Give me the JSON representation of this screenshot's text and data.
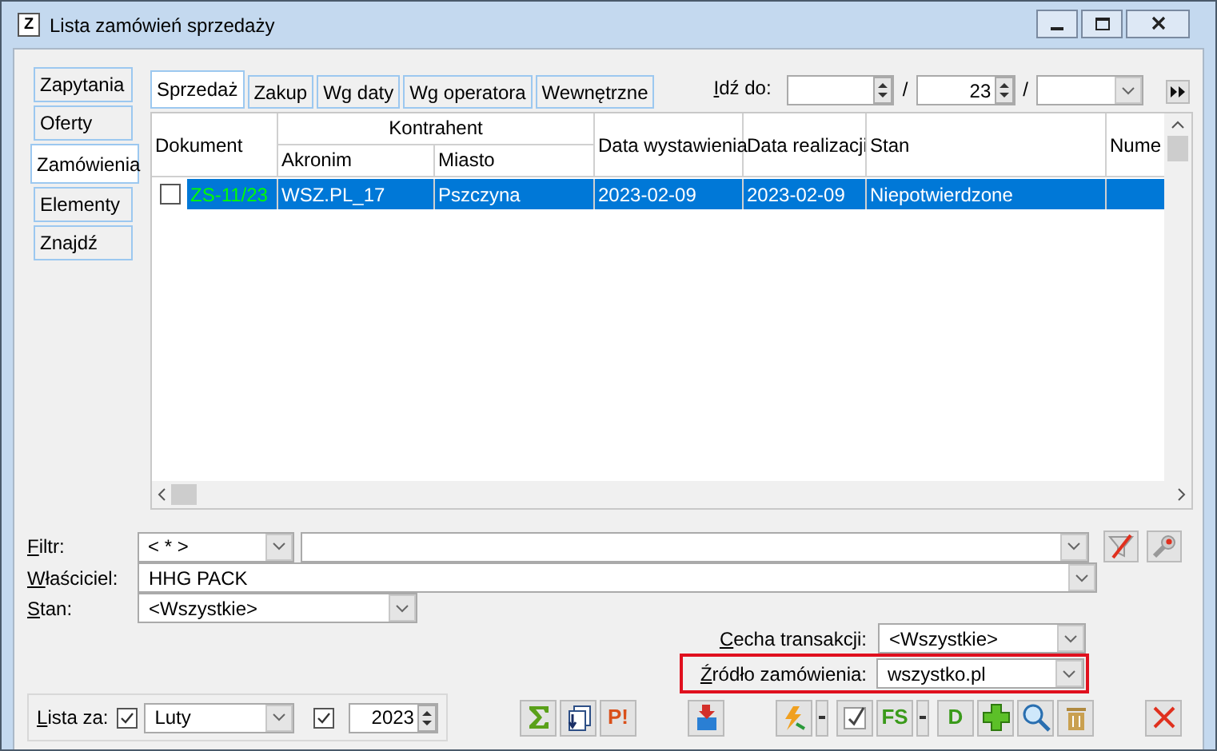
{
  "window": {
    "title": "Lista zamówień sprzedaży",
    "app_icon": "Z"
  },
  "sidebar": {
    "items": [
      {
        "label": "Zapytania",
        "selected": false
      },
      {
        "label": "Oferty",
        "selected": false
      },
      {
        "label": "Zamówienia",
        "selected": true
      },
      {
        "label": "Elementy",
        "selected": false
      },
      {
        "label": "Znajdź",
        "selected": false
      }
    ]
  },
  "tabs": [
    {
      "label": "Sprzedaż",
      "selected": true
    },
    {
      "label": "Zakup",
      "selected": false
    },
    {
      "label": "Wg daty",
      "selected": false
    },
    {
      "label": "Wg operatora",
      "selected": false
    },
    {
      "label": "Wewnętrzne",
      "selected": false
    }
  ],
  "goto": {
    "label": "Idź do:",
    "separator_1": "/",
    "number": "23",
    "separator_2": "/"
  },
  "table": {
    "columns": {
      "dokument": "Dokument",
      "kontrahent": "Kontrahent",
      "akronim": "Akronim",
      "miasto": "Miasto",
      "data_wystawienia": "Data wystawienia",
      "data_realizacji": "Data realizacji",
      "stan": "Stan",
      "column_8": "Nume"
    },
    "rows": [
      {
        "checked": false,
        "selected": true,
        "dokument": "ZS-11/23",
        "akronim": "WSZ.PL_17",
        "miasto": "Pszczyna",
        "data_wystawienia": "2023-02-09",
        "data_realizacji": "2023-02-09",
        "stan": "Niepotwierdzone"
      }
    ]
  },
  "filters": {
    "filtr": {
      "label": "Filtr:",
      "value": "< * >"
    },
    "wlasciciel": {
      "label": "Właściciel:",
      "value": "HHG PACK"
    },
    "stan": {
      "label": "Stan:",
      "value": "<Wszystkie>"
    },
    "cecha": {
      "label": "Cecha transakcji:",
      "value": "<Wszystkie>"
    },
    "zrodlo": {
      "label": "Źródło zamówienia:",
      "value": "wszystko.pl",
      "highlighted": true
    }
  },
  "lista_za": {
    "label": "Lista za:",
    "month_checked": true,
    "month": "Luty",
    "year_checked": true,
    "year": "2023"
  },
  "toolbar": [
    {
      "kind": "sum"
    },
    {
      "kind": "copy"
    },
    {
      "kind": "letters",
      "text": "P!"
    },
    {
      "kind": "gap"
    },
    {
      "kind": "import"
    },
    {
      "kind": "gap"
    },
    {
      "kind": "lightning"
    },
    {
      "kind": "dropdown"
    },
    {
      "kind": "check"
    },
    {
      "kind": "letters",
      "text": "FS"
    },
    {
      "kind": "dropdown"
    },
    {
      "kind": "letters",
      "text": "D"
    },
    {
      "kind": "plus"
    },
    {
      "kind": "search"
    },
    {
      "kind": "trash"
    },
    {
      "kind": "wide_gap"
    },
    {
      "kind": "close"
    }
  ]
}
